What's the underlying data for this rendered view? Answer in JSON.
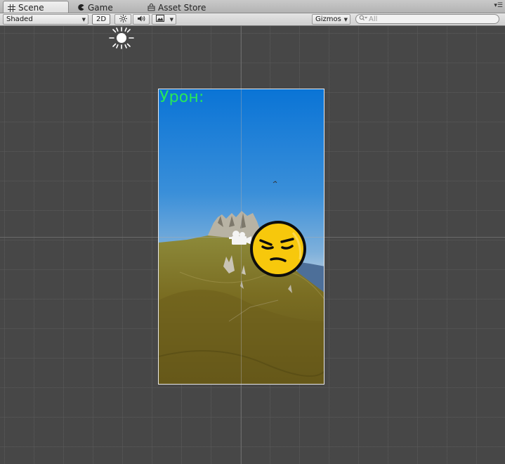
{
  "tabs": [
    {
      "label": "Scene",
      "icon": "grid-icon",
      "active": true
    },
    {
      "label": "Game",
      "icon": "pacman-icon",
      "active": false
    },
    {
      "label": "Asset Store",
      "icon": "bag-icon",
      "active": false
    }
  ],
  "toolbar": {
    "shading_mode": "Shaded",
    "mode_2d_label": "2D",
    "gizmos_label": "Gizmos",
    "search_placeholder": "All",
    "lighting_icon": "sun-icon",
    "audio_icon": "speaker-icon",
    "effects_icon": "image-icon"
  },
  "scene": {
    "damage_label": "Урон:",
    "sprite": "angry-emoji",
    "background": "mountain-landscape"
  },
  "colors": {
    "scene_background": "#474747",
    "damage_text": "#27e85a",
    "emoji_fill": "#f7c80c"
  }
}
